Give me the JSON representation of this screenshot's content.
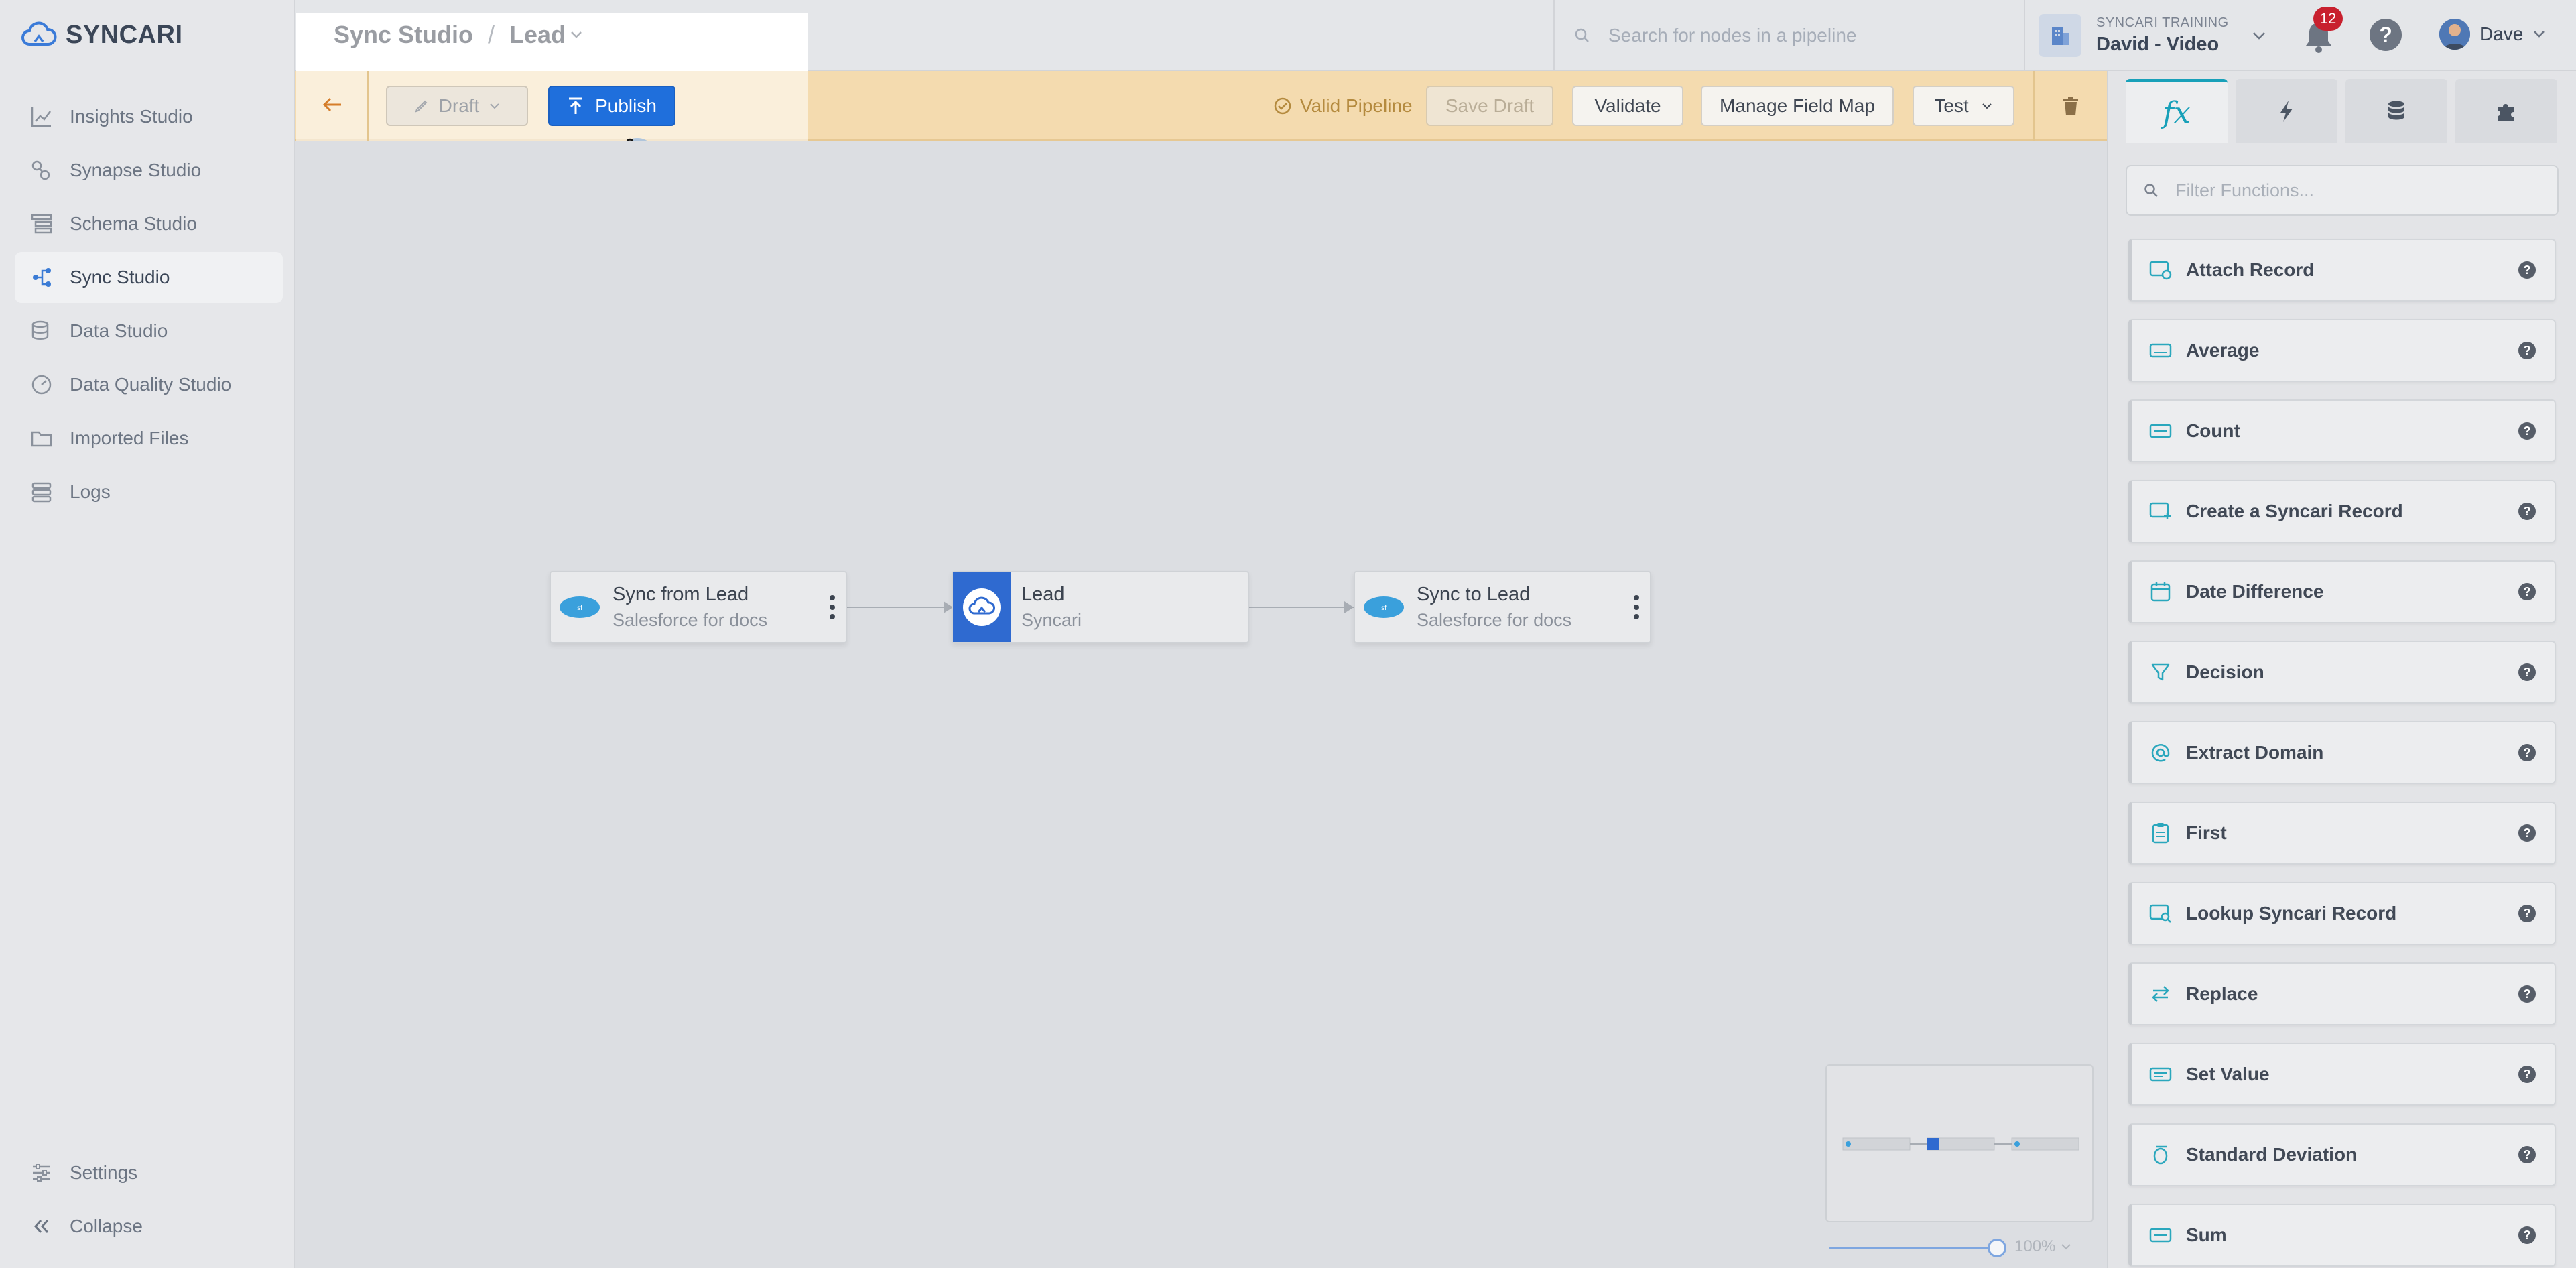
{
  "app": {
    "logo_text": "SYNCARI"
  },
  "sidebar": {
    "items": [
      {
        "label": "Insights Studio",
        "icon": "chart-icon"
      },
      {
        "label": "Synapse Studio",
        "icon": "synapse-icon"
      },
      {
        "label": "Schema Studio",
        "icon": "schema-icon"
      },
      {
        "label": "Sync Studio",
        "icon": "sync-icon",
        "active": true
      },
      {
        "label": "Data Studio",
        "icon": "database-icon"
      },
      {
        "label": "Data Quality Studio",
        "icon": "gauge-icon"
      },
      {
        "label": "Imported Files",
        "icon": "folder-icon"
      },
      {
        "label": "Logs",
        "icon": "logs-icon"
      }
    ],
    "settings_label": "Settings",
    "collapse_label": "Collapse"
  },
  "header": {
    "breadcrumb_root": "Sync Studio",
    "breadcrumb_separator": "/",
    "breadcrumb_current": "Lead",
    "search_placeholder": "Search for nodes in a pipeline",
    "org_label": "SYNCARI TRAINING",
    "org_name": "David - Video",
    "notification_count": "12",
    "help_glyph": "?",
    "user_name": "Dave"
  },
  "toolbar": {
    "draft_label": "Draft",
    "publish_label": "Publish",
    "valid_label": "Valid Pipeline",
    "save_draft_label": "Save Draft",
    "validate_label": "Validate",
    "field_map_label": "Manage Field Map",
    "test_label": "Test"
  },
  "pipeline": {
    "nodes": [
      {
        "title": "Sync from Lead",
        "subtitle": "Salesforce for docs",
        "icon": "salesforce-icon"
      },
      {
        "title": "Lead",
        "subtitle": "Syncari",
        "icon": "syncari-cloud-icon"
      },
      {
        "title": "Sync to Lead",
        "subtitle": "Salesforce for docs",
        "icon": "salesforce-icon"
      }
    ],
    "zoom_label": "100%"
  },
  "right_panel": {
    "tabs": [
      {
        "label": "fx",
        "icon": "functions-icon"
      },
      {
        "icon": "bolt-icon"
      },
      {
        "icon": "database-icon"
      },
      {
        "icon": "puzzle-icon"
      }
    ],
    "filter_placeholder": "Filter Functions...",
    "functions": [
      {
        "label": "Attach Record",
        "icon": "attach-record-icon"
      },
      {
        "label": "Average",
        "icon": "average-icon"
      },
      {
        "label": "Count",
        "icon": "count-icon"
      },
      {
        "label": "Create a Syncari Record",
        "icon": "create-record-icon"
      },
      {
        "label": "Date Difference",
        "icon": "calendar-icon"
      },
      {
        "label": "Decision",
        "icon": "funnel-icon"
      },
      {
        "label": "Extract Domain",
        "icon": "at-icon"
      },
      {
        "label": "First",
        "icon": "clipboard-icon"
      },
      {
        "label": "Lookup Syncari Record",
        "icon": "lookup-icon"
      },
      {
        "label": "Replace",
        "icon": "swap-icon"
      },
      {
        "label": "Set Value",
        "icon": "set-value-icon"
      },
      {
        "label": "Standard Deviation",
        "icon": "sigma-icon"
      },
      {
        "label": "Sum",
        "icon": "sum-icon"
      }
    ],
    "info_glyph": "?"
  },
  "colors": {
    "accent_teal": "#18a0b9",
    "publish_blue": "#1f6fdc",
    "toolbar_bg": "#f4dbaf",
    "badge_red": "#c8202e"
  }
}
